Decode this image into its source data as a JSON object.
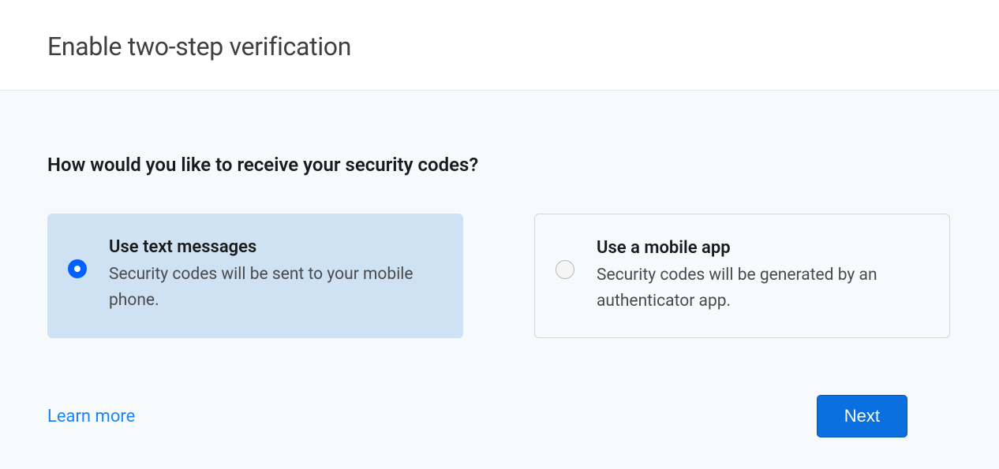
{
  "header": {
    "title": "Enable two-step verification"
  },
  "content": {
    "question": "How would you like to receive your security codes?",
    "options": [
      {
        "title": "Use text messages",
        "description": "Security codes will be sent to your mobile phone.",
        "selected": true
      },
      {
        "title": "Use a mobile app",
        "description": "Security codes will be generated by an authenticator app.",
        "selected": false
      }
    ],
    "learn_more_label": "Learn more",
    "next_button_label": "Next"
  }
}
